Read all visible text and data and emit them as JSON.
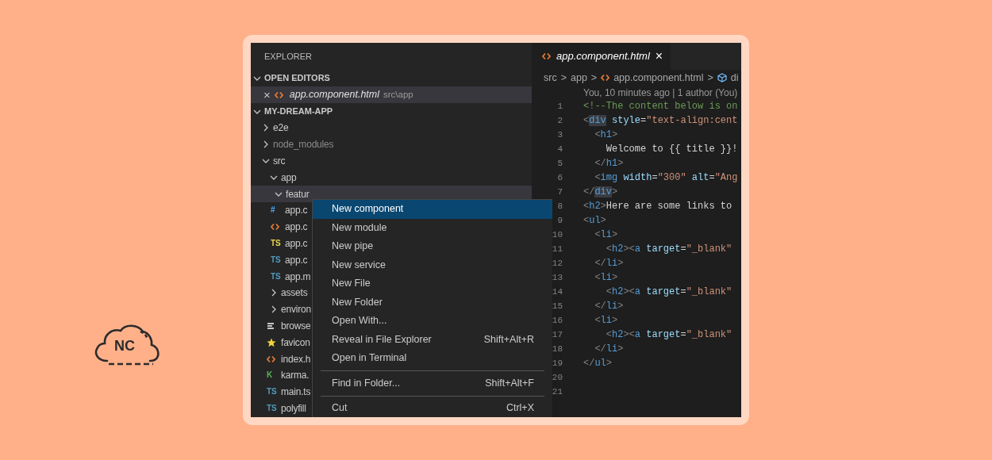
{
  "logo": {
    "text": "NC"
  },
  "explorer": {
    "title": "EXPLORER",
    "sections": [
      {
        "title": "OPEN EDITORS",
        "expanded": true
      },
      {
        "title": "MY-DREAM-APP",
        "expanded": true
      }
    ],
    "open_editors": [
      {
        "close": "×",
        "name": "app.component.html",
        "path": "src\\app",
        "preview": true,
        "selected": true,
        "icon": {
          "kind": "markup",
          "color": "#e37933"
        }
      }
    ],
    "tree": [
      {
        "kind": "folder",
        "name": "e2e",
        "expanded": false,
        "dimmed": false,
        "selected": false
      },
      {
        "kind": "folder",
        "name": "node_modules",
        "expanded": false,
        "dimmed": true,
        "selected": false
      },
      {
        "kind": "folder",
        "name": "src",
        "expanded": true,
        "dimmed": false,
        "selected": false,
        "children": [
          {
            "kind": "folder",
            "name": "app",
            "expanded": true,
            "dimmed": false,
            "selected": false,
            "children": [
              {
                "kind": "folder",
                "name": "featur",
                "expanded": true,
                "dimmed": false,
                "selected": true,
                "children": [
                  {
                    "kind": "file",
                    "name": "app.c",
                    "selected": false,
                    "icon": {
                      "kind": "letters",
                      "glyph": "#",
                      "color": "#42a5f5"
                    }
                  },
                  {
                    "kind": "file",
                    "name": "app.c",
                    "selected": false,
                    "icon": {
                      "kind": "markup",
                      "color": "#e37933"
                    }
                  },
                  {
                    "kind": "file",
                    "name": "app.c",
                    "selected": false,
                    "icon": {
                      "kind": "letters",
                      "glyph": "TS",
                      "color": "#e8d44d"
                    }
                  },
                  {
                    "kind": "file",
                    "name": "app.c",
                    "selected": false,
                    "icon": {
                      "kind": "letters",
                      "glyph": "TS",
                      "color": "#519aba"
                    }
                  },
                  {
                    "kind": "file",
                    "name": "app.m",
                    "selected": false,
                    "icon": {
                      "kind": "letters",
                      "glyph": "TS",
                      "color": "#519aba"
                    }
                  }
                ]
              }
            ]
          },
          {
            "kind": "folder",
            "name": "assets",
            "expanded": false,
            "dimmed": false,
            "selected": false
          },
          {
            "kind": "folder",
            "name": "environ",
            "expanded": false,
            "dimmed": false,
            "selected": false
          },
          {
            "kind": "file",
            "name": "browse",
            "selected": false,
            "icon": {
              "kind": "lines",
              "color": "#c5c5c5"
            }
          },
          {
            "kind": "file",
            "name": "favicon",
            "selected": false,
            "icon": {
              "kind": "star",
              "color": "#f2d335"
            }
          },
          {
            "kind": "file",
            "name": "index.h",
            "selected": false,
            "icon": {
              "kind": "markup",
              "color": "#e37933"
            }
          },
          {
            "kind": "file",
            "name": "karma.",
            "selected": false,
            "icon": {
              "kind": "letters",
              "glyph": "K",
              "color": "#56b856"
            }
          },
          {
            "kind": "file",
            "name": "main.ts",
            "selected": false,
            "icon": {
              "kind": "letters",
              "glyph": "TS",
              "color": "#519aba"
            }
          },
          {
            "kind": "file",
            "name": "polyfill",
            "selected": false,
            "icon": {
              "kind": "letters",
              "glyph": "TS",
              "color": "#519aba"
            }
          }
        ]
      }
    ]
  },
  "context_menu": [
    {
      "kind": "item",
      "label": "New component",
      "selected": true
    },
    {
      "kind": "item",
      "label": "New module",
      "selected": false
    },
    {
      "kind": "item",
      "label": "New pipe",
      "selected": false
    },
    {
      "kind": "item",
      "label": "New service",
      "selected": false
    },
    {
      "kind": "item",
      "label": "New File",
      "selected": false
    },
    {
      "kind": "item",
      "label": "New Folder",
      "selected": false
    },
    {
      "kind": "item",
      "label": "Open With...",
      "selected": false
    },
    {
      "kind": "item",
      "label": "Reveal in File Explorer",
      "shortcut": "Shift+Alt+R",
      "selected": false
    },
    {
      "kind": "item",
      "label": "Open in Terminal",
      "selected": false
    },
    {
      "kind": "separator"
    },
    {
      "kind": "item",
      "label": "Find in Folder...",
      "shortcut": "Shift+Alt+F",
      "selected": false
    },
    {
      "kind": "separator"
    },
    {
      "kind": "item",
      "label": "Cut",
      "shortcut": "Ctrl+X",
      "selected": false
    }
  ],
  "editor": {
    "tab": {
      "title": "app.component.html",
      "close": "×",
      "preview": true,
      "selected": true
    },
    "breadcrumb": {
      "separator": ">",
      "items": [
        {
          "kind": "folder",
          "text": "src"
        },
        {
          "kind": "folder",
          "text": "app"
        },
        {
          "kind": "file",
          "text": "app.component.html"
        },
        {
          "kind": "symbol",
          "text": "di"
        }
      ]
    },
    "blame": "You, 10 minutes ago | 1 author (You)",
    "lines": [
      {
        "number": "1",
        "text": "<!--The content below is on"
      },
      {
        "number": "2",
        "text": "<div style=\"text-align:cent",
        "match": true
      },
      {
        "number": "3",
        "text": "  <h1>",
        "match": false
      },
      {
        "number": "4",
        "text": "    Welcome to {{ title }}!"
      },
      {
        "number": "5",
        "text": "  </h1>",
        "match": false
      },
      {
        "number": "6",
        "text": "  <img width=\"300\" alt=\"Ang",
        "match": false
      },
      {
        "number": "7",
        "text": "</div>",
        "match": true
      },
      {
        "number": "8",
        "text": "<h2>Here are some links to",
        "match": false
      },
      {
        "number": "9",
        "text": "<ul>",
        "match": false
      },
      {
        "number": "10",
        "text": "  <li>",
        "match": false
      },
      {
        "number": "11",
        "text": "    <h2><a target=\"_blank\"",
        "match": false
      },
      {
        "number": "12",
        "text": "  </li>",
        "match": false
      },
      {
        "number": "13",
        "text": "  <li>",
        "match": false
      },
      {
        "number": "14",
        "text": "    <h2><a target=\"_blank\"",
        "match": false
      },
      {
        "number": "15",
        "text": "  </li>",
        "match": false
      },
      {
        "number": "16",
        "text": "  <li>",
        "match": false
      },
      {
        "number": "17",
        "text": "    <h2><a target=\"_blank\"",
        "match": false
      },
      {
        "number": "18",
        "text": "  </li>",
        "match": false
      },
      {
        "number": "19",
        "text": "</ul>",
        "match": false
      },
      {
        "number": "20"
      },
      {
        "number": "21"
      }
    ]
  }
}
